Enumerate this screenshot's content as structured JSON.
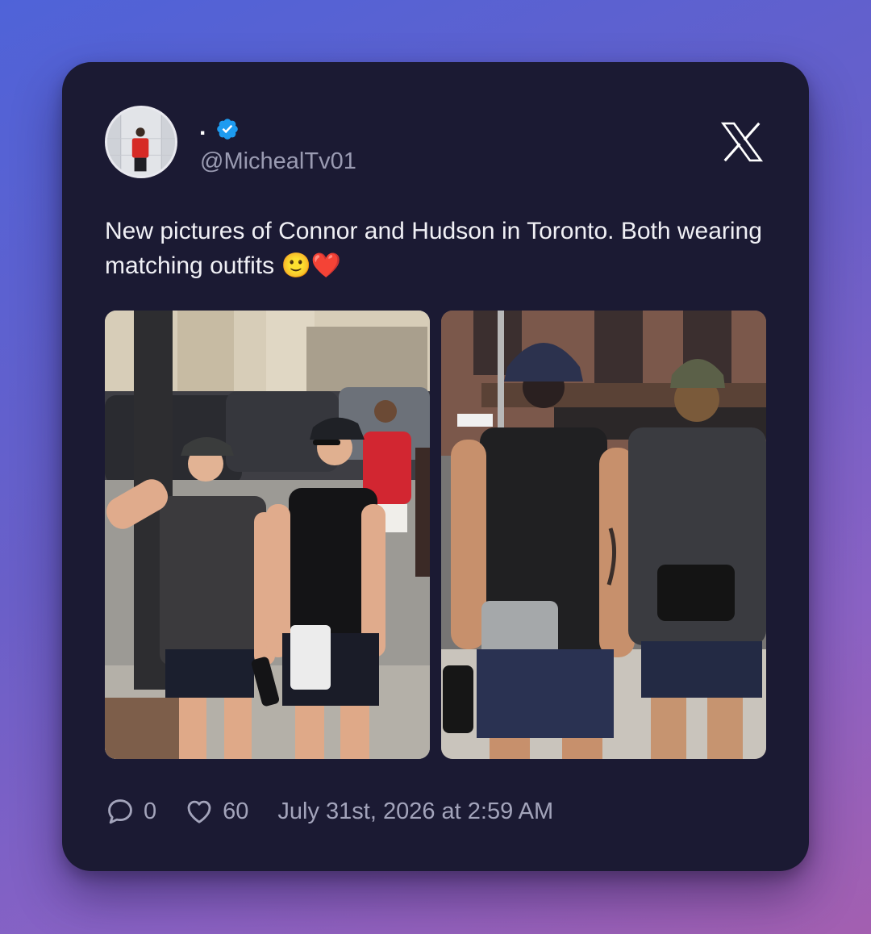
{
  "tweet": {
    "display_name": ".",
    "handle": "@MichealTv01",
    "text": "New pictures of Connor and Hudson in Toronto. Both wearing matching outfits 🙂❤️",
    "replies": "0",
    "likes": "60",
    "timestamp": "July 31st, 2026 at 2:59 AM"
  },
  "icons": {
    "verified": "verified-badge-icon",
    "platform": "x-logo-icon",
    "reply": "reply-icon",
    "like": "heart-icon"
  },
  "colors": {
    "card_bg": "#1b1a33",
    "verified_blue": "#1d9bf0",
    "muted_text": "#a3a4bb"
  }
}
